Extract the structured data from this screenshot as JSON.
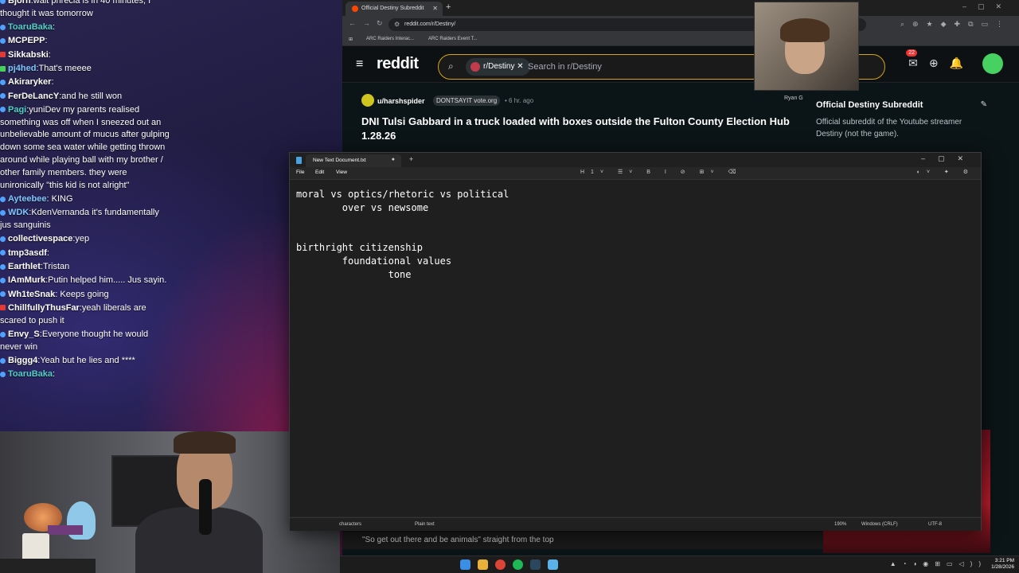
{
  "chat": {
    "messages": [
      {
        "user": "Bjorn",
        "color": "#ffffff",
        "badge": "blue",
        "text": "wait phrecia is in 40 minutes, I thought it was tomorrow"
      },
      {
        "user": "ToaruBaka",
        "color": "#4fd1c5",
        "badge": "blue",
        "text": ""
      },
      {
        "user": "MCPEPP",
        "color": "#ffffff",
        "badge": "blue",
        "text": ""
      },
      {
        "user": "Sikkabski",
        "color": "#ffffff",
        "badge": "red",
        "text": ""
      },
      {
        "user": "pj4hed",
        "color": "#7ec8ff",
        "badge": "green",
        "text": "That's meeee"
      },
      {
        "user": "Akiraryker",
        "color": "#ffffff",
        "badge": "blue",
        "text": ""
      },
      {
        "user": "FerDeLancY",
        "color": "#ffffff",
        "badge": "blue",
        "text": "and he still won"
      },
      {
        "user": "Pagi",
        "color": "#4fd1c5",
        "badge": "blue",
        "text": "yuniDev  my parents realised something was off when I sneezed out an unbelievable amount of mucus after gulping down some sea water while getting thrown around while playing ball with my brother / other family members. they were unironically  \"this kid is not alright\""
      },
      {
        "user": "Ayteebee",
        "color": "#7ec8ff",
        "badge": "blue",
        "text": " KING"
      },
      {
        "user": "WDK",
        "color": "#7ec8ff",
        "badge": "blue",
        "text": "KdenVernanda it's fundamentally jus sanguinis"
      },
      {
        "user": "collectivespace",
        "color": "#ffffff",
        "badge": "blue",
        "text": "yep"
      },
      {
        "user": "tmp3asdf",
        "color": "#ffffff",
        "badge": "blue",
        "text": ""
      },
      {
        "user": "Earthlet",
        "color": "#ffffff",
        "badge": "blue",
        "text": "Tristan"
      },
      {
        "user": "IAmMurk",
        "color": "#ffffff",
        "badge": "blue",
        "text": "Putin helped him..... Jus sayin."
      },
      {
        "user": "Wh1teSnak",
        "color": "#ffffff",
        "badge": "blue",
        "text": " Keeps going"
      },
      {
        "user": "ChillfullyThusFar",
        "color": "#ffffff",
        "badge": "red",
        "text": "yeah liberals are scared to push it"
      },
      {
        "user": "Envy_S",
        "color": "#ffffff",
        "badge": "blue",
        "text": "Everyone thought he would never win"
      },
      {
        "user": "Biggg4",
        "color": "#ffffff",
        "badge": "blue",
        "text": "Yeah but he lies and ****"
      },
      {
        "user": "ToaruBaka",
        "color": "#4fd1c5",
        "badge": "blue",
        "text": ""
      }
    ]
  },
  "browser": {
    "tab_title": "Official Destiny Subreddit",
    "url": "reddit.com/r/Destiny/",
    "bookmarks": [
      "ARC Raiders Interac...",
      "ARC Raiders Event T..."
    ]
  },
  "reddit": {
    "logo_text": "reddit",
    "search_chip": "r/Destiny",
    "search_placeholder": "Search in r/Destiny",
    "notif_count": "22",
    "post": {
      "user": "u/harshspider",
      "flair": "DONTSAYIT vote.org",
      "time": "• 6 hr. ago",
      "title": "DNI Tulsi Gabbard in a truck loaded with boxes outside the Fulton County Election Hub 1.28.26"
    },
    "sidebar": {
      "byline": "Ryan G",
      "title": "Official Destiny Subreddit",
      "description": "Official subreddit of the Youtube streamer Destiny (not the game)."
    },
    "now_playing": "\"So get out there and be animals\" straight from the top"
  },
  "notepad": {
    "tab_title": "New Text Document.txt",
    "menu": [
      "File",
      "Edit",
      "View"
    ],
    "heading_tool": "H1",
    "content": "moral vs optics/rhetoric vs political\n        over vs newsome\n\n\nbirthright citizenship\n        foundational values\n                tone",
    "status": {
      "chars": "characters",
      "format": "Plain text",
      "zoom": "190%",
      "line_ending": "Windows (CRLF)",
      "encoding": "UTF-8"
    }
  },
  "taskbar": {
    "time": "3:21 PM",
    "date": "1/28/2026"
  }
}
